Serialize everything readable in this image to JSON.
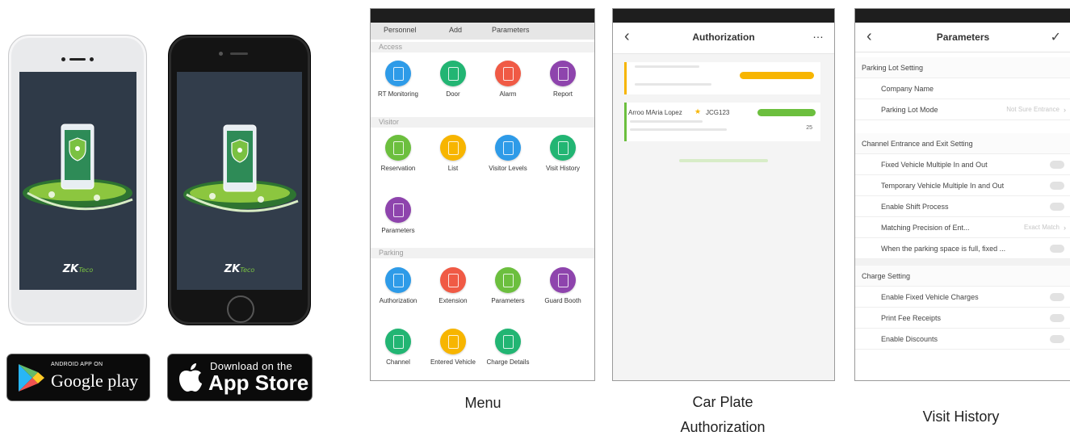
{
  "phones": {
    "brand_name": "ZKTeco"
  },
  "badges": {
    "google_small": "ANDROID APP ON",
    "google_big": "Google play",
    "apple_small": "Download on the",
    "apple_big": "App Store"
  },
  "menu_screen": {
    "tabs": [
      "Personnel",
      "Add",
      "Parameters"
    ],
    "sections": [
      {
        "title": "Access",
        "items": [
          {
            "label": "RT Monitoring",
            "color": "#2e9be8"
          },
          {
            "label": "Door",
            "color": "#22b573"
          },
          {
            "label": "Alarm",
            "color": "#f05a45"
          },
          {
            "label": "Report",
            "color": "#8e44ad"
          }
        ]
      },
      {
        "title": "Visitor",
        "items": [
          {
            "label": "Reservation",
            "color": "#6cbf3e"
          },
          {
            "label": "List",
            "color": "#f7b500"
          },
          {
            "label": "Visitor Levels",
            "color": "#2e9be8"
          },
          {
            "label": "Visit History",
            "color": "#22b573"
          },
          {
            "label": "Parameters",
            "color": "#8e44ad"
          }
        ]
      },
      {
        "title": "Parking",
        "items": [
          {
            "label": "Authorization",
            "color": "#2e9be8"
          },
          {
            "label": "Extension",
            "color": "#f05a45"
          },
          {
            "label": "Parameters",
            "color": "#6cbf3e"
          },
          {
            "label": "Guard Booth",
            "color": "#8e44ad"
          },
          {
            "label": "Channel",
            "color": "#22b573"
          },
          {
            "label": "Entered Vehicle",
            "color": "#f7b500"
          },
          {
            "label": "Charge Details",
            "color": "#22b573"
          }
        ]
      }
    ]
  },
  "auth_screen": {
    "title": "Authorization",
    "more": "…",
    "record_name": "Arroo MAria Lopez",
    "record_plate": "JCG123",
    "record_count": "25",
    "accent_orange": "#f7b500",
    "accent_green": "#6cbf3e"
  },
  "param_screen": {
    "title": "Parameters",
    "rows": [
      {
        "type": "head",
        "label": "Parking Lot Setting"
      },
      {
        "type": "item",
        "label": "Company Name"
      },
      {
        "type": "item",
        "label": "Parking Lot Mode",
        "value": "Not Sure Entrance",
        "control": "chevron"
      },
      {
        "type": "head",
        "label": "Channel Entrance and Exit Setting"
      },
      {
        "type": "item",
        "label": "Fixed Vehicle Multiple In and Out",
        "control": "toggle"
      },
      {
        "type": "item",
        "label": "Temporary Vehicle Multiple In and Out",
        "control": "toggle"
      },
      {
        "type": "item",
        "label": "Enable Shift Process",
        "control": "toggle"
      },
      {
        "type": "item",
        "label": "Matching Precision of Ent...",
        "value": "Exact Match",
        "control": "chevron"
      },
      {
        "type": "item",
        "label": "When the parking space is full, fixed ...",
        "control": "toggle"
      },
      {
        "type": "head",
        "label": "Charge Setting"
      },
      {
        "type": "item",
        "label": "Enable Fixed Vehicle Charges",
        "control": "toggle"
      },
      {
        "type": "item",
        "label": "Print Fee Receipts",
        "control": "toggle"
      },
      {
        "type": "item",
        "label": "Enable Discounts",
        "control": "toggle"
      }
    ]
  },
  "captions": {
    "menu": "Menu",
    "auth_line1": "Car Plate",
    "auth_line2": "Authorization",
    "visit": "Visit History"
  }
}
